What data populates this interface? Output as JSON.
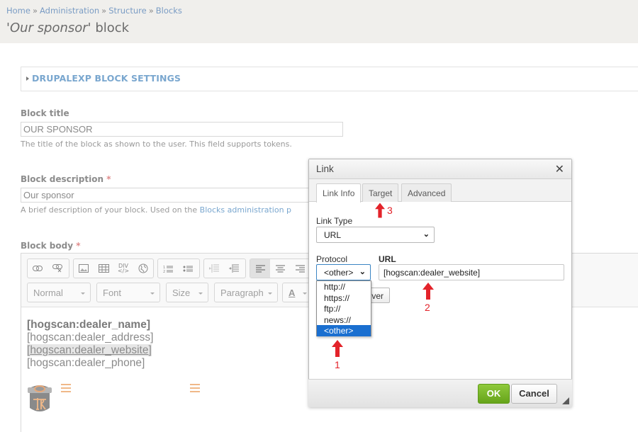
{
  "breadcrumb": [
    {
      "label": "Home"
    },
    {
      "label": "Administration"
    },
    {
      "label": "Structure"
    },
    {
      "label": "Blocks"
    }
  ],
  "breadcrumb_separator": "»",
  "page_title": {
    "prefix": "'",
    "italic": "Our sponsor",
    "suffix": "' block"
  },
  "fieldset": {
    "legend": "DRUPALEXP BLOCK SETTINGS"
  },
  "block_title": {
    "label": "Block title",
    "value": "OUR SPONSOR",
    "description": "The title of the block as shown to the user. This field supports tokens."
  },
  "block_description": {
    "label": "Block description",
    "required_mark": "*",
    "value": "Our sponsor",
    "description_prefix": "A brief description of your block. Used on the ",
    "description_link": "Blocks administration p"
  },
  "block_body": {
    "label": "Block body",
    "required_mark": "*",
    "toolbar": {
      "groups": [
        [
          "link-icon",
          "unlink-icon"
        ],
        [
          "image-icon",
          "table-icon",
          "div-container-icon",
          "iframe-globe-icon"
        ],
        [
          "numbered-list-icon",
          "bulleted-list-icon"
        ],
        [
          "outdent-icon",
          "indent-icon"
        ],
        [
          "align-left-icon",
          "align-center-icon",
          "align-right-icon"
        ]
      ],
      "combos": [
        {
          "label": "Normal"
        },
        {
          "label": "Font"
        },
        {
          "label": "Size"
        },
        {
          "label": "Paragraph"
        }
      ],
      "text_color_label": "A"
    },
    "content": {
      "line1": "[hogscan:dealer_name]",
      "line2": "[hogscan:dealer_address]",
      "line3_open": "[",
      "line3_link": "hogscan:dealer_website",
      "line3_close": "]",
      "line4": "[hogscan:dealer_phone]"
    }
  },
  "dialog": {
    "title": "Link",
    "close_icon": "close-icon",
    "tabs": [
      {
        "label": "Link Info",
        "active": true
      },
      {
        "label": "Target",
        "active": false
      },
      {
        "label": "Advanced",
        "active": false
      }
    ],
    "link_type": {
      "label": "Link Type",
      "value": "URL"
    },
    "protocol": {
      "label": "Protocol",
      "value": "<other>",
      "options": [
        "http://",
        "https://",
        "ftp://",
        "news://",
        "<other>"
      ],
      "selected_index": 4
    },
    "url": {
      "label": "URL",
      "value": "[hogscan:dealer_website]"
    },
    "browse_server_visible_text": "ver",
    "ok_label": "OK",
    "cancel_label": "Cancel"
  },
  "annotations": [
    {
      "number": "1",
      "color": "#e3232a"
    },
    {
      "number": "2",
      "color": "#e3232a"
    },
    {
      "number": "3",
      "color": "#e3232a"
    }
  ]
}
